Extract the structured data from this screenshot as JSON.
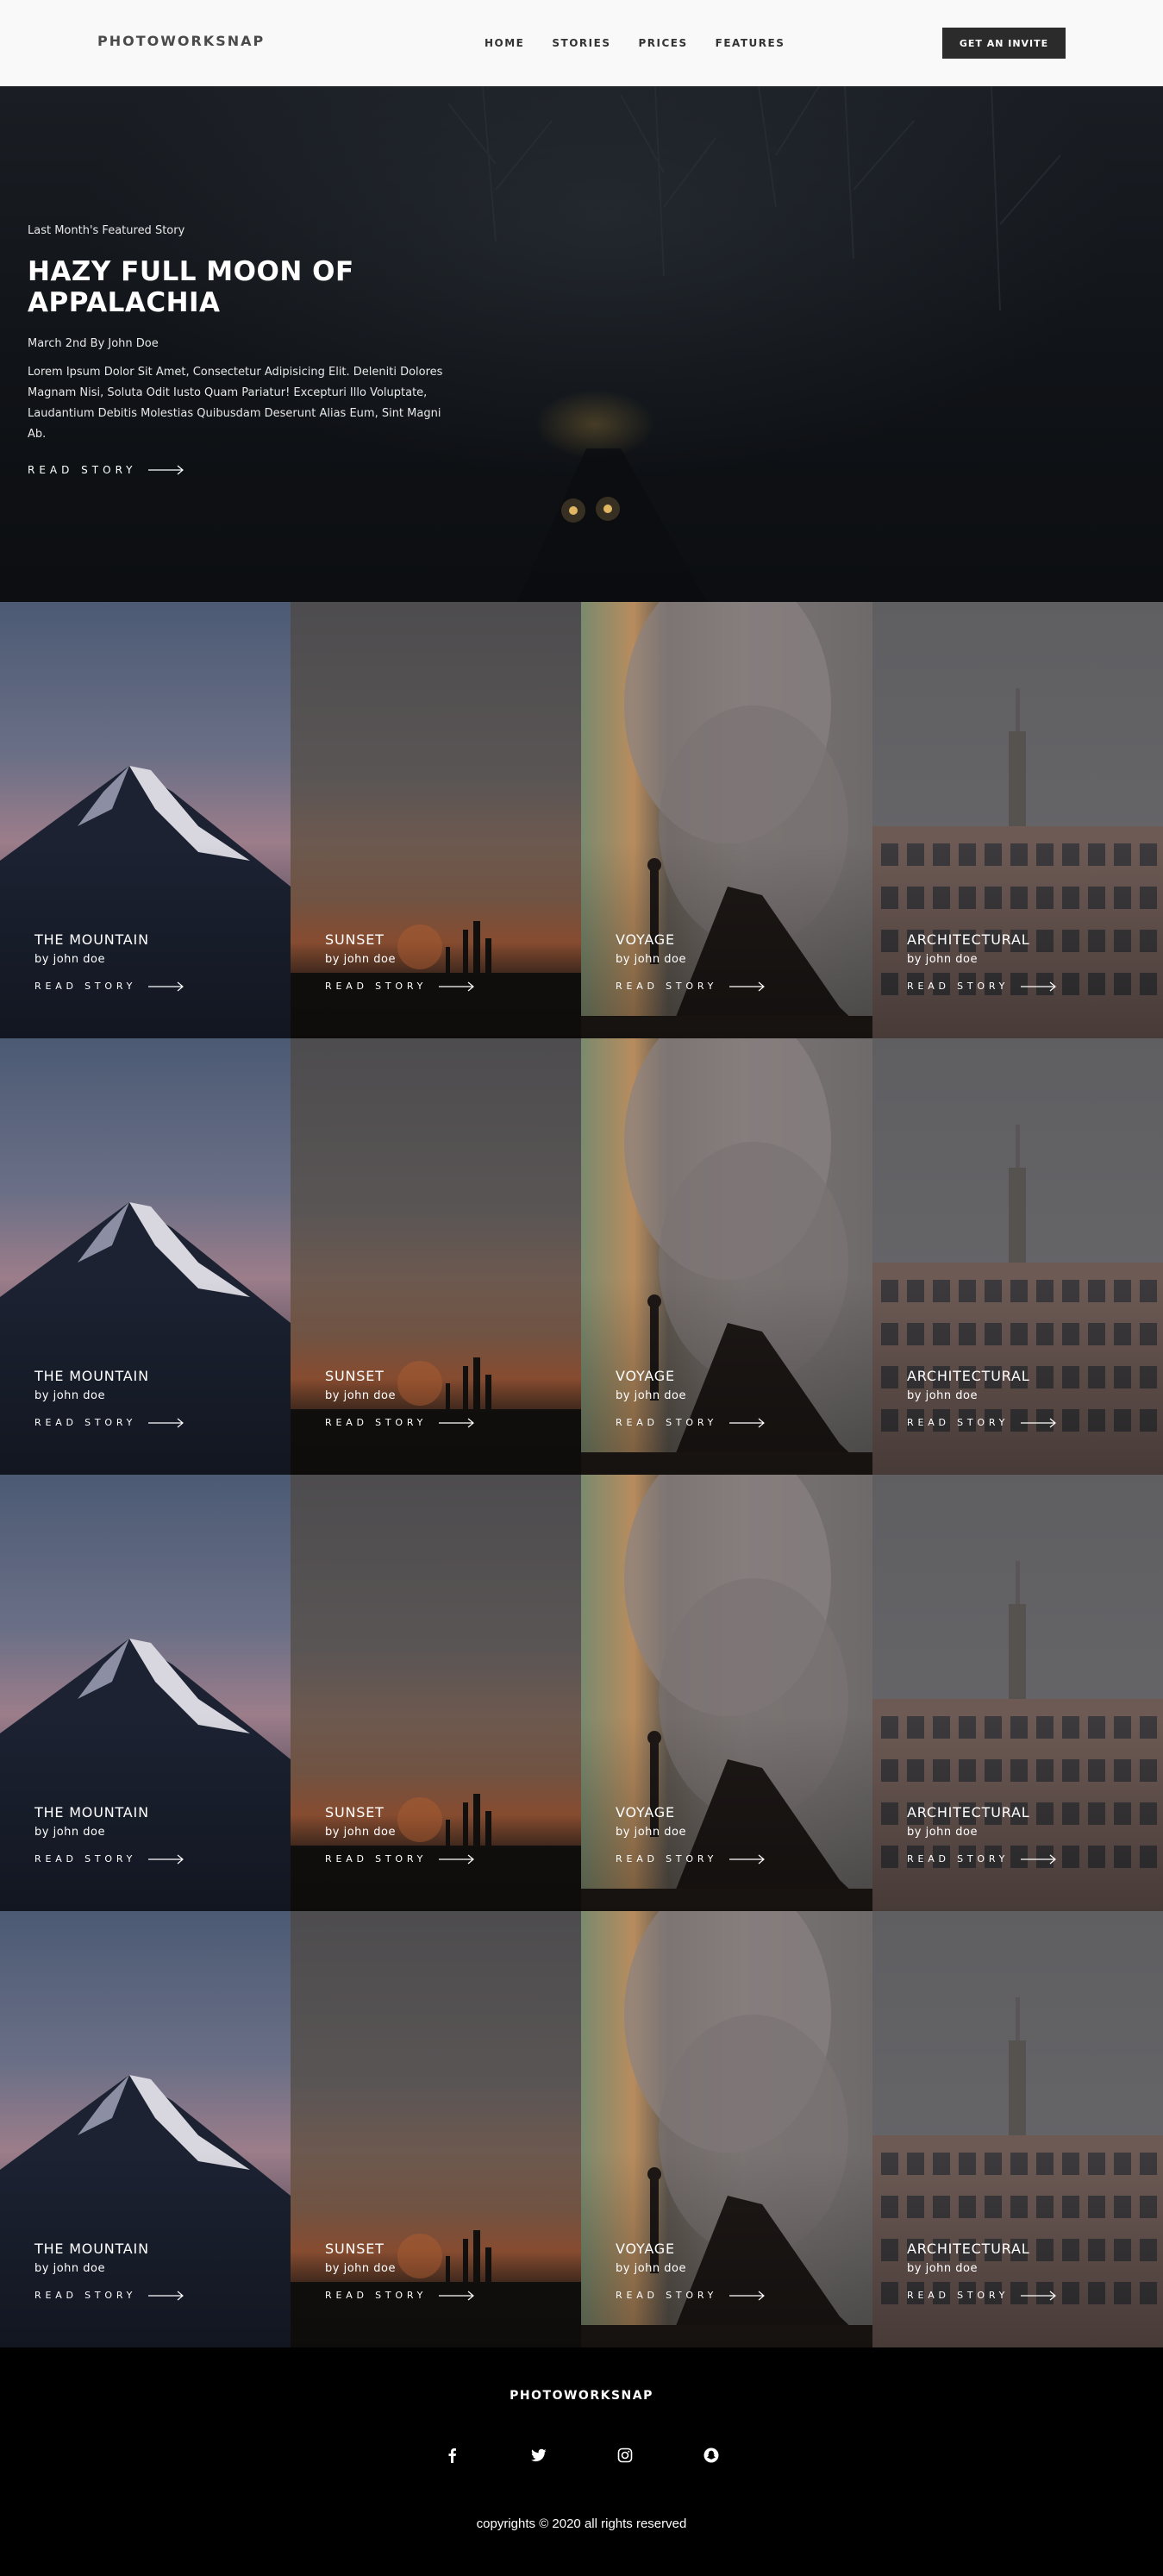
{
  "header": {
    "logo": "PHOTOWORKSNAP",
    "nav": [
      "HOME",
      "STORIES",
      "PRICES",
      "FEATURES"
    ],
    "cta": "GET AN INVITE"
  },
  "hero": {
    "eyebrow": "Last Month's Featured Story",
    "title": "HAZY FULL MOON OF APPALACHIA",
    "date": "March 2nd By John Doe",
    "description": "Lorem Ipsum Dolor Sit Amet, Consectetur Adipisicing Elit. Deleniti Dolores Magnam Nisi, Soluta Odit Iusto Quam Pariatur! Excepturi Illo Voluptate, Laudantium Debitis Molestias Quibusdam Deserunt Alias Eum, Sint Magni Ab.",
    "link": "READ STORY"
  },
  "gallery": {
    "cards": [
      {
        "title": "THE MOUNTAIN",
        "author": "by john doe",
        "link": "READ STORY"
      },
      {
        "title": "SUNSET",
        "author": "by john doe",
        "link": "READ STORY"
      },
      {
        "title": "VOYAGE",
        "author": "by john doe",
        "link": "READ STORY"
      },
      {
        "title": "ARCHITECTURAL",
        "author": "by john doe",
        "link": "READ STORY"
      },
      {
        "title": "THE MOUNTAIN",
        "author": "by john doe",
        "link": "READ STORY"
      },
      {
        "title": "SUNSET",
        "author": "by john doe",
        "link": "READ STORY"
      },
      {
        "title": "VOYAGE",
        "author": "by john doe",
        "link": "READ STORY"
      },
      {
        "title": "ARCHITECTURAL",
        "author": "by john doe",
        "link": "READ STORY"
      },
      {
        "title": "THE MOUNTAIN",
        "author": "by john doe",
        "link": "READ STORY"
      },
      {
        "title": "SUNSET",
        "author": "by john doe",
        "link": "READ STORY"
      },
      {
        "title": "VOYAGE",
        "author": "by john doe",
        "link": "READ STORY"
      },
      {
        "title": "ARCHITECTURAL",
        "author": "by john doe",
        "link": "READ STORY"
      },
      {
        "title": "THE MOUNTAIN",
        "author": "by john doe",
        "link": "READ STORY"
      },
      {
        "title": "SUNSET",
        "author": "by john doe",
        "link": "READ STORY"
      },
      {
        "title": "VOYAGE",
        "author": "by john doe",
        "link": "READ STORY"
      },
      {
        "title": "ARCHITECTURAL",
        "author": "by john doe",
        "link": "READ STORY"
      }
    ]
  },
  "footer": {
    "logo": "PHOTOWORKSNAP",
    "socials": [
      "facebook-icon",
      "twitter-icon",
      "instagram-icon",
      "snapchat-icon"
    ],
    "copyright": "copyrights © 2020 all rights reserved"
  }
}
